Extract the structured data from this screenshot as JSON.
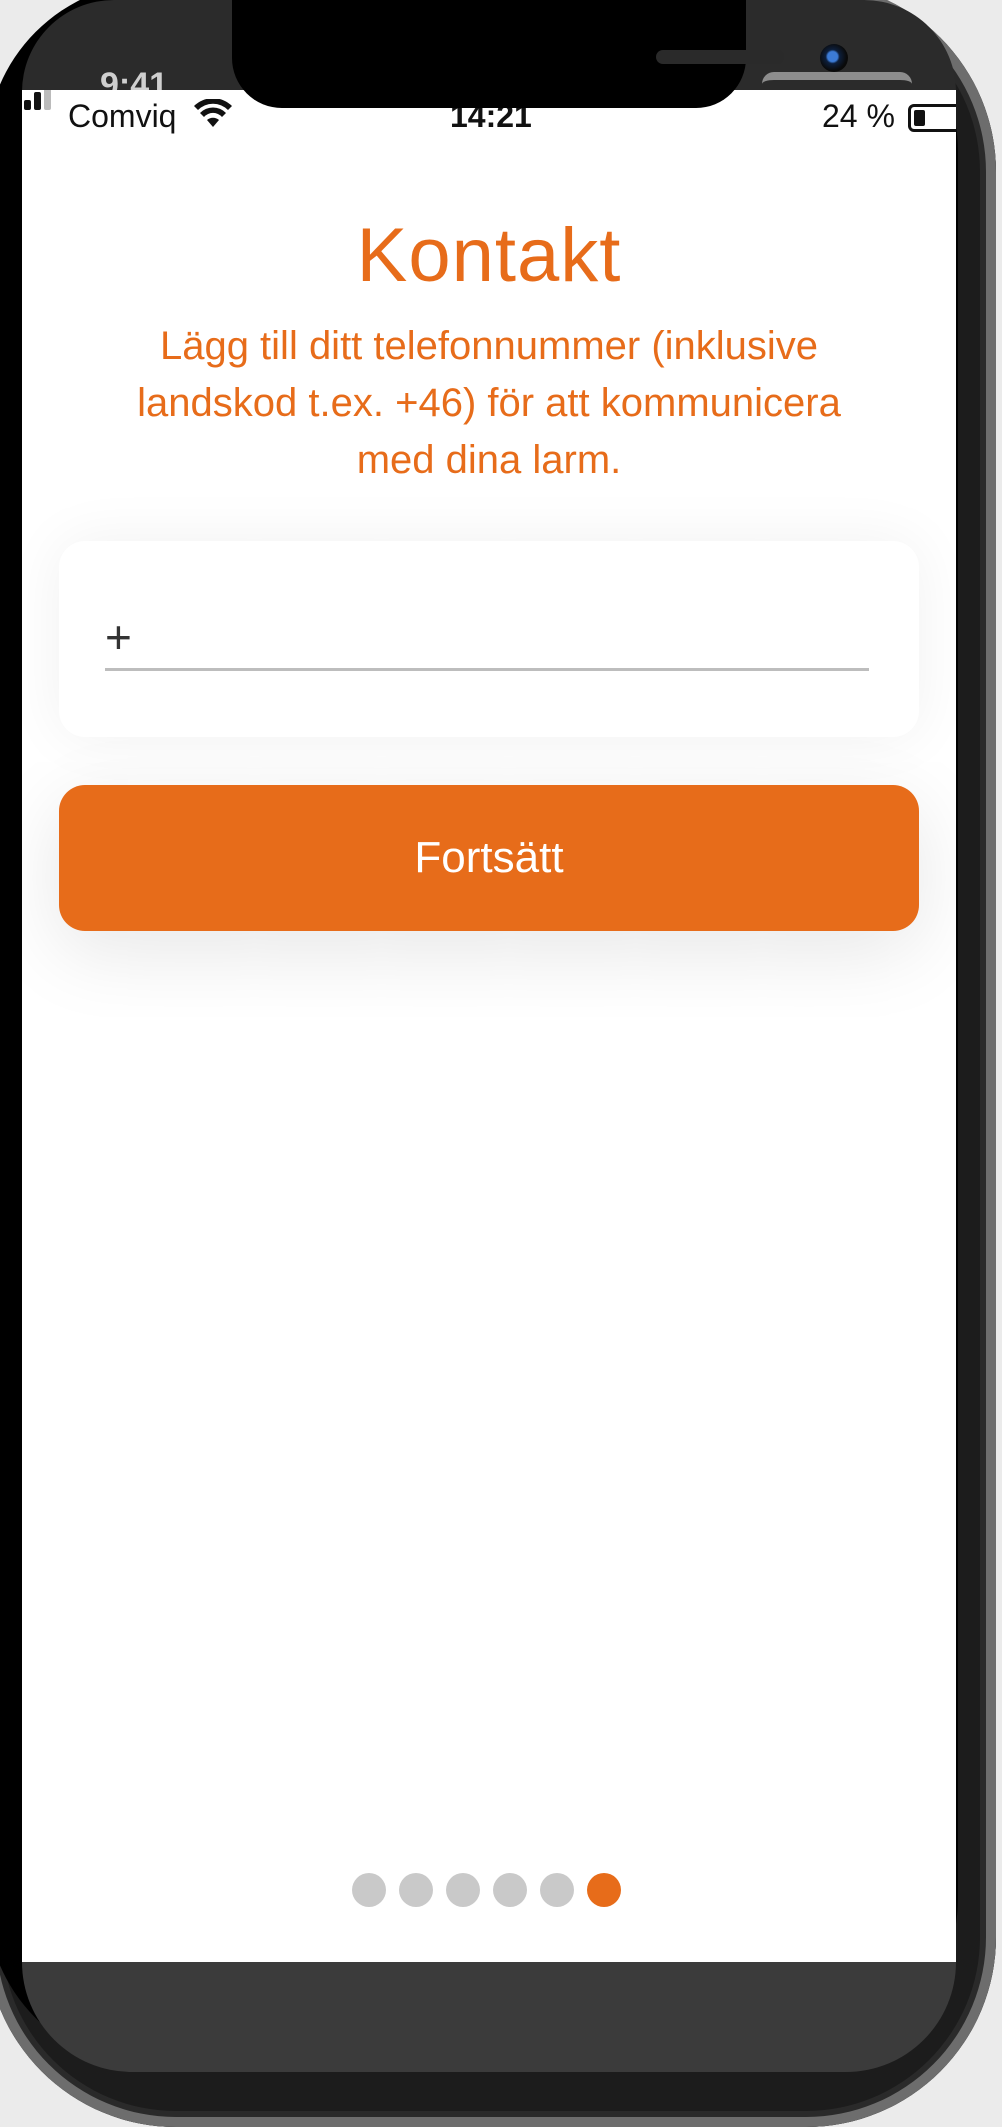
{
  "status_bar": {
    "carrier": "Comviq",
    "time": "14:21",
    "battery_percent": "24 %",
    "battery_level": 0.24,
    "ghost_time": "9:41"
  },
  "page": {
    "title": "Kontakt",
    "subtitle": "Lägg till ditt telefonnummer (inklusive landskod t.ex. +46) för att kommunicera med dina larm."
  },
  "phone_input": {
    "value": "+"
  },
  "continue_button": {
    "label": "Fortsätt"
  },
  "pager": {
    "total": 6,
    "active_index": 5
  },
  "colors": {
    "accent": "#e76c1a",
    "dot_inactive": "#c9c9c9"
  }
}
